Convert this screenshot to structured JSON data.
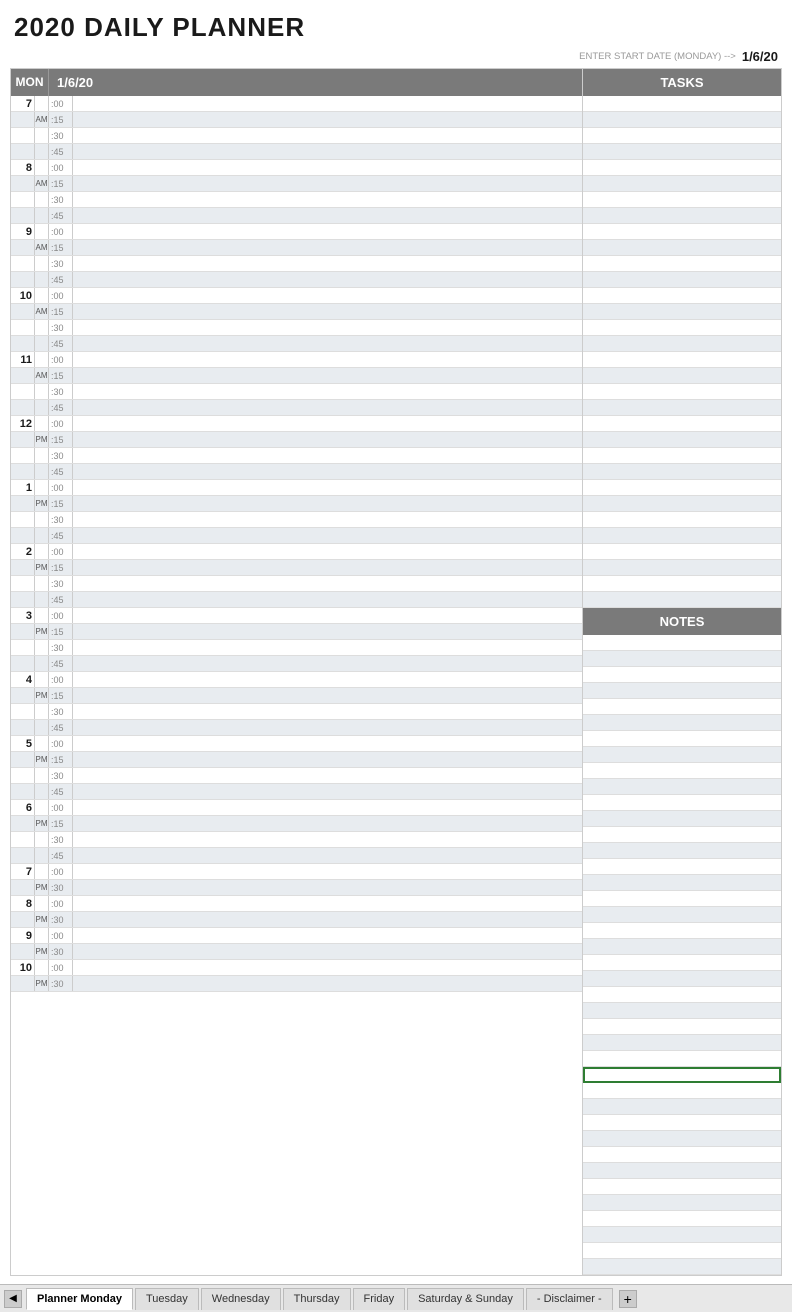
{
  "title": "2020 DAILY PLANNER",
  "start_date_label": "ENTER START DATE (MONDAY) -->",
  "start_date_value": "1/6/20",
  "planner_header": {
    "day": "MON",
    "date": "1/6/20"
  },
  "tasks_header": "TASKS",
  "notes_header": "NOTES",
  "time_slots": [
    {
      "hour": "7",
      "ampm": "AM",
      "slots": [
        ":00",
        ":15",
        ":30",
        ":45"
      ]
    },
    {
      "hour": "8",
      "ampm": "AM",
      "slots": [
        ":00",
        ":15",
        ":30",
        ":45"
      ]
    },
    {
      "hour": "9",
      "ampm": "AM",
      "slots": [
        ":00",
        ":15",
        ":30",
        ":45"
      ]
    },
    {
      "hour": "10",
      "ampm": "AM",
      "slots": [
        ":00",
        ":15",
        ":30",
        ":45"
      ]
    },
    {
      "hour": "11",
      "ampm": "AM",
      "slots": [
        ":00",
        ":15",
        ":30",
        ":45"
      ]
    },
    {
      "hour": "12",
      "ampm": "PM",
      "slots": [
        ":00",
        ":15",
        ":30",
        ":45"
      ]
    },
    {
      "hour": "1",
      "ampm": "PM",
      "slots": [
        ":00",
        ":15",
        ":30",
        ":45"
      ]
    },
    {
      "hour": "2",
      "ampm": "PM",
      "slots": [
        ":00",
        ":15",
        ":30",
        ":45"
      ]
    },
    {
      "hour": "3",
      "ampm": "PM",
      "slots": [
        ":00",
        ":15",
        ":30",
        ":45"
      ]
    },
    {
      "hour": "4",
      "ampm": "PM",
      "slots": [
        ":00",
        ":15",
        ":30",
        ":45"
      ]
    },
    {
      "hour": "5",
      "ampm": "PM",
      "slots": [
        ":00",
        ":15",
        ":30",
        ":45"
      ]
    },
    {
      "hour": "6",
      "ampm": "PM",
      "slots": [
        ":00",
        ":15",
        ":30",
        ":45"
      ]
    },
    {
      "hour": "7",
      "ampm": "PM",
      "slots": [
        ":00",
        ":30"
      ]
    },
    {
      "hour": "8",
      "ampm": "PM",
      "slots": [
        ":00",
        ":30"
      ]
    },
    {
      "hour": "9",
      "ampm": "PM",
      "slots": [
        ":00",
        ":30"
      ]
    },
    {
      "hour": "10",
      "ampm": "PM",
      "slots": [
        ":00",
        ":30"
      ]
    }
  ],
  "tabs": [
    {
      "label": "Planner Monday",
      "active": true
    },
    {
      "label": "Tuesday",
      "active": false
    },
    {
      "label": "Wednesday",
      "active": false
    },
    {
      "label": "Thursday",
      "active": false
    },
    {
      "label": "Friday",
      "active": false
    },
    {
      "label": "Saturday & Sunday",
      "active": false
    },
    {
      "label": "- Disclaimer -",
      "active": false
    }
  ]
}
